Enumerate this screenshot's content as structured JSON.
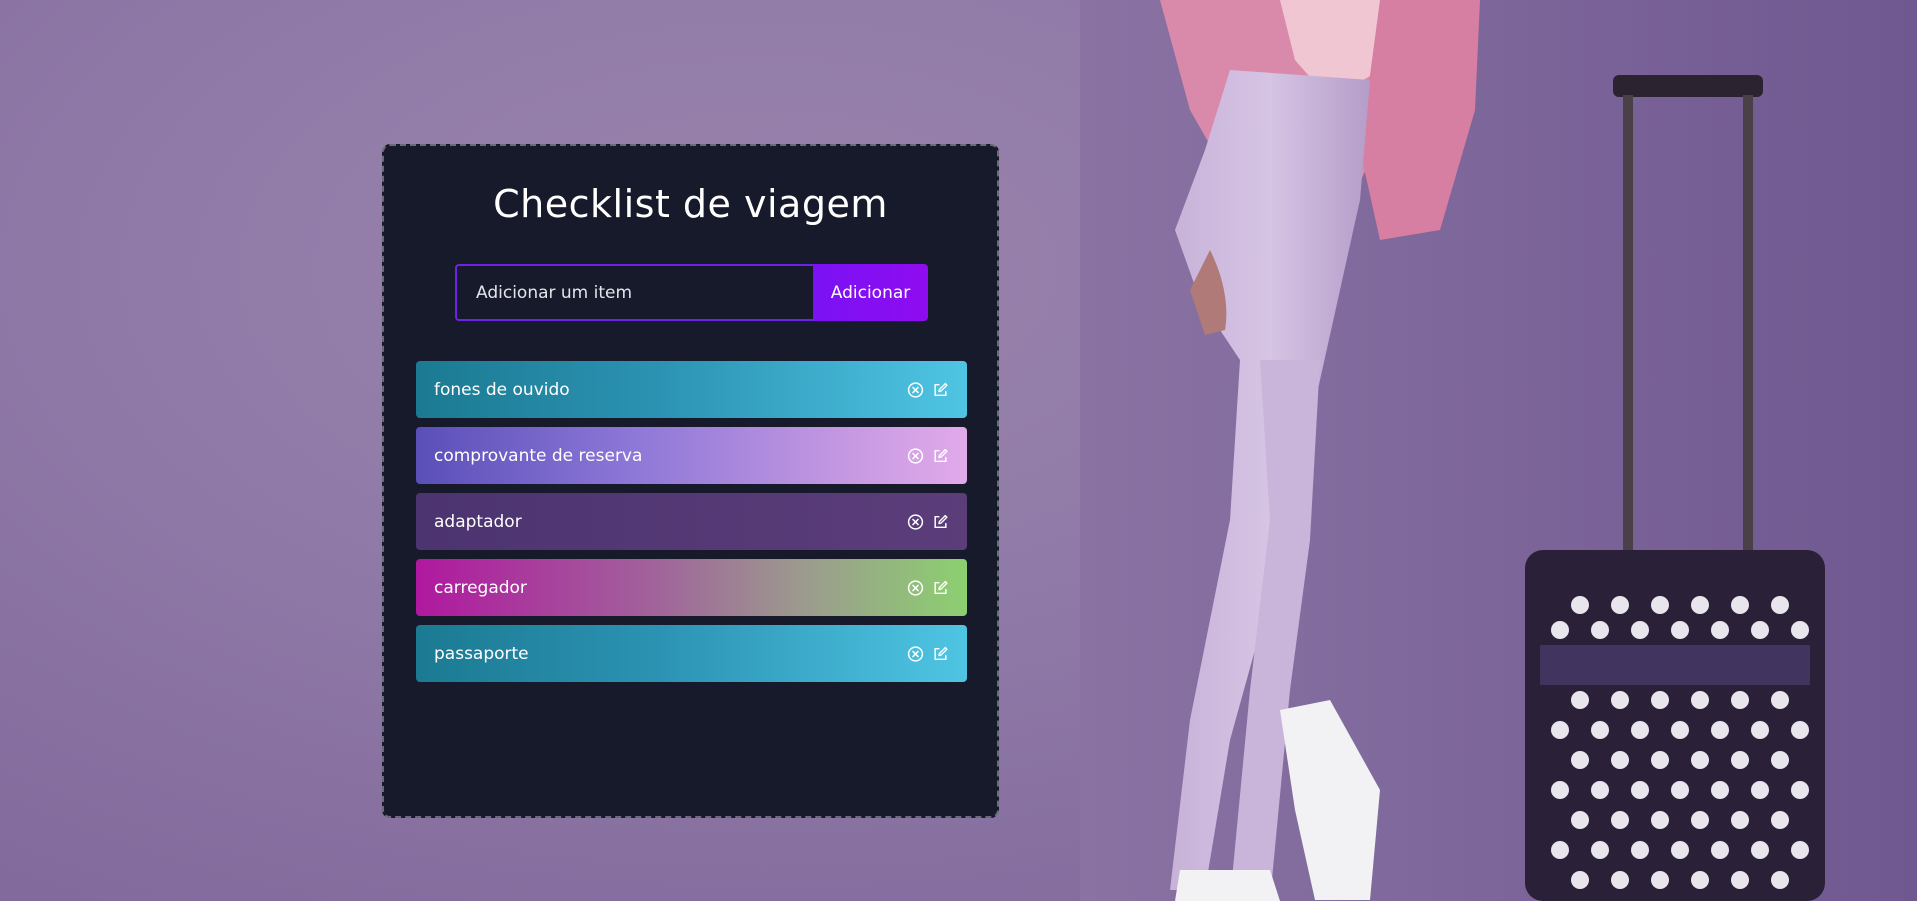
{
  "app": {
    "title": "Checklist de viagem"
  },
  "form": {
    "placeholder": "Adicionar um item",
    "value": "",
    "button_label": "Adicionar"
  },
  "items": [
    {
      "label": "fones de ouvido",
      "color_theme": "cyan-gradient"
    },
    {
      "label": "comprovante de reserva",
      "color_theme": "purple-gradient"
    },
    {
      "label": "adaptador",
      "color_theme": "plum"
    },
    {
      "label": "carregador",
      "color_theme": "magenta-green-gradient"
    },
    {
      "label": "passaporte",
      "color_theme": "cyan-gradient"
    }
  ],
  "icons": {
    "remove": "close-circle-icon",
    "edit": "edit-icon"
  },
  "colors": {
    "background": "#8e78a6",
    "card": "#171a2b",
    "accent": "#7a12f4",
    "input_border": "#6d22e8"
  }
}
